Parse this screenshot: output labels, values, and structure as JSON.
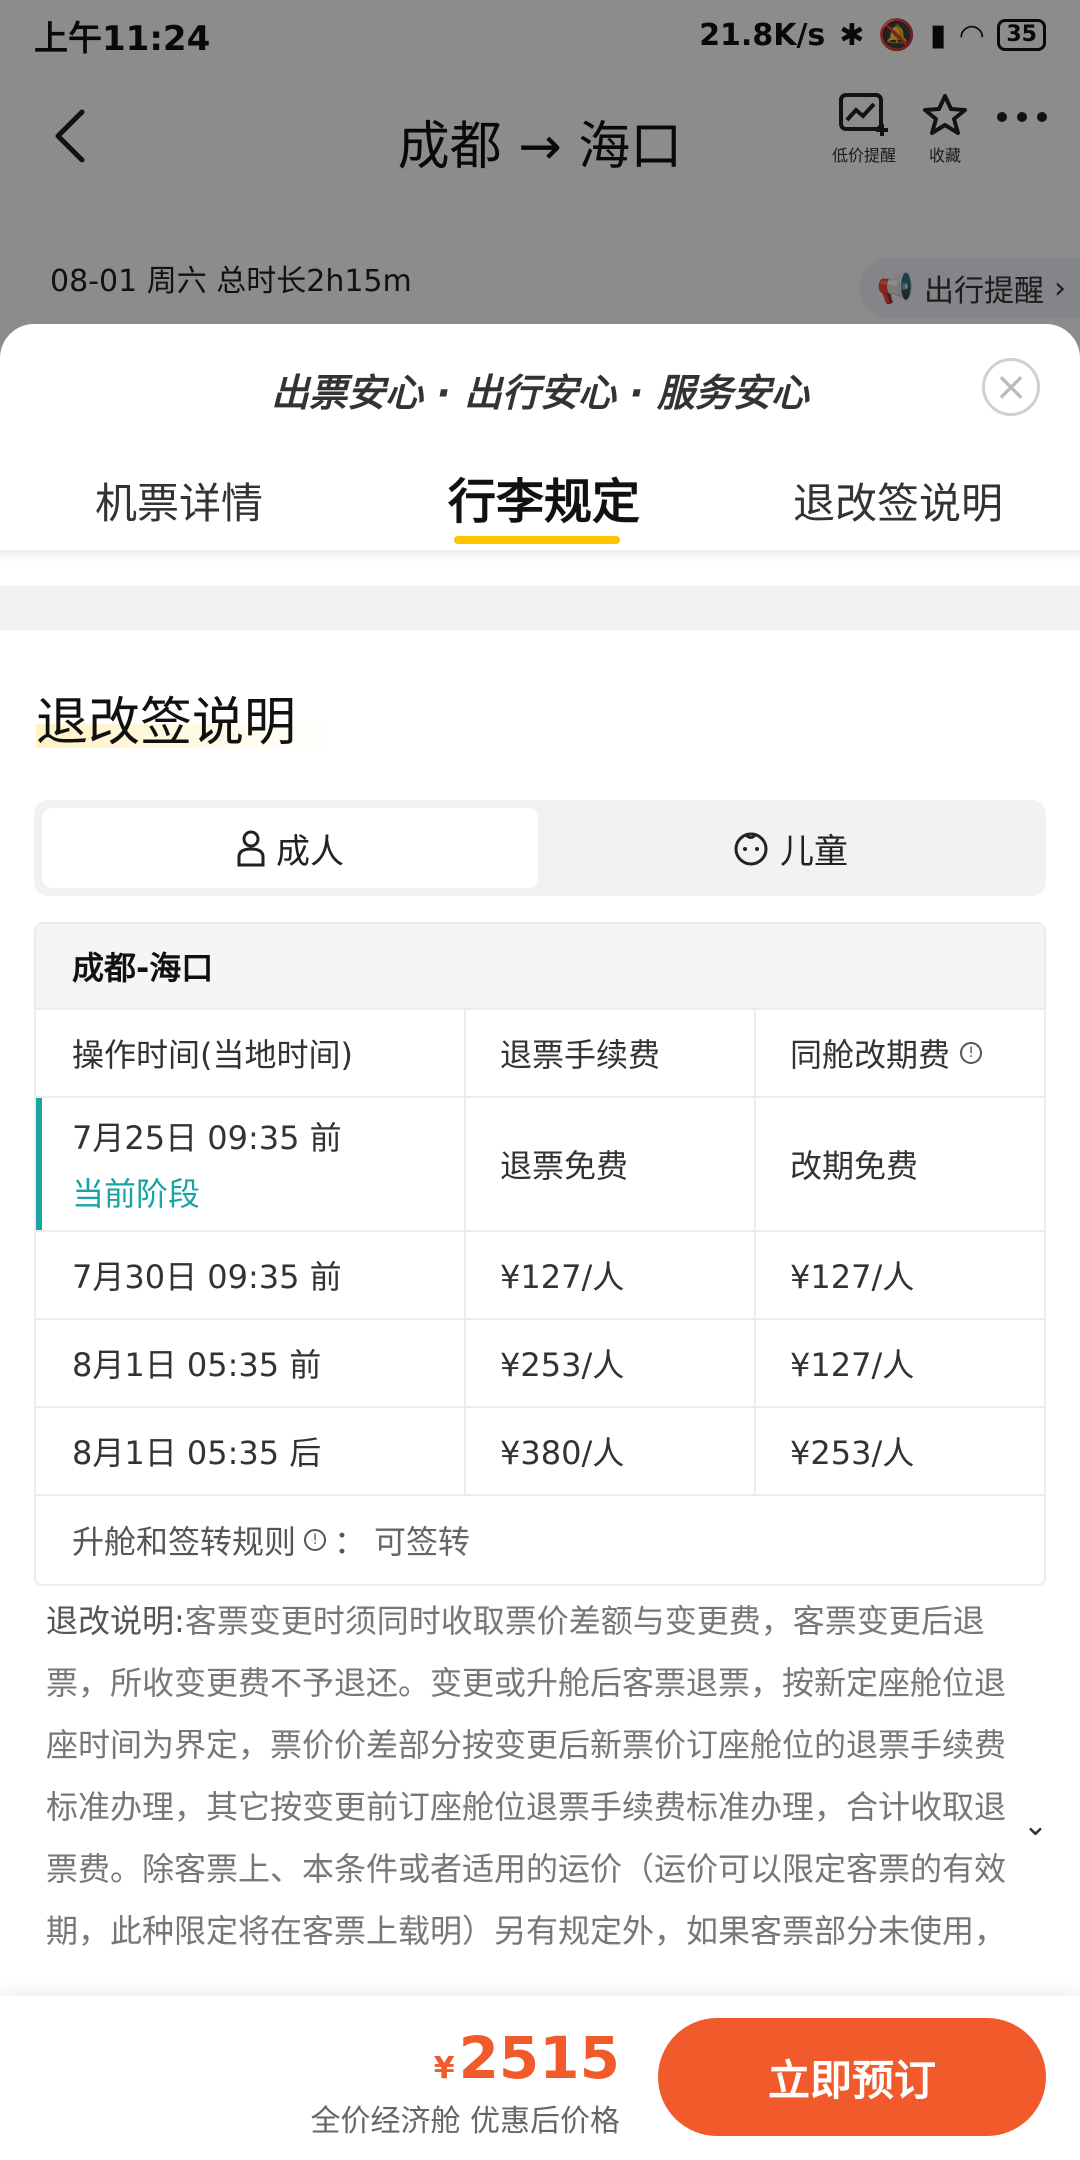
{
  "status_bar": {
    "time": "上午11:24",
    "network_speed": "21.8K/s",
    "battery": "35"
  },
  "header": {
    "title": "成都 → 海口",
    "low_price_alert_label": "低价提醒",
    "favorite_label": "收藏"
  },
  "trip": {
    "info": "08-01 周六  总时长2h15m",
    "travel_tip": "出行提醒"
  },
  "sheet": {
    "slogan": "出票安心 · 出行安心 · 服务安心",
    "tabs": [
      "机票详情",
      "行李规定",
      "退改签说明"
    ],
    "active_tab": 1,
    "section_title": "退改签说明",
    "passenger_types": [
      "成人",
      "儿童"
    ],
    "table": {
      "route": "成都-海口",
      "headers": [
        "操作时间(当地时间)",
        "退票手续费",
        "同舱改期费"
      ],
      "rows": [
        {
          "time": "7月25日 09:35 前",
          "stage": "当前阶段",
          "refund": "退票免费",
          "change": "改期免费"
        },
        {
          "time": "7月30日 09:35 前",
          "refund": "¥127/人",
          "change": "¥127/人"
        },
        {
          "time": "8月1日 05:35 前",
          "refund": "¥253/人",
          "change": "¥127/人"
        },
        {
          "time": "8月1日 05:35 后",
          "refund": "¥380/人",
          "change": "¥253/人"
        }
      ],
      "footer_label": "升舱和签转规则",
      "footer_value": "可签转"
    },
    "description_label": "退改说明:",
    "description": "客票变更时须同时收取票价差额与变更费，客票变更后退票，所收变更费不予退还。变更或升舱后客票退票，按新定座舱位退座时间为界定，票价价差部分按变更后新票价订座舱位的退票手续费标准办理，其它按变更前订座舱位退票手续费标准办理，合计收取退票费。除客票上、本条件或者适用的运价（运价可以限定客票的有效期，此种限定将在客票上载明）另有规定外，如果客票部分未使用，客票有效期自首段旅行之日起，一年内运输有效；如果客票全部未使用的（包括不定期客票），则…"
  },
  "bottom": {
    "currency": "¥",
    "price": "2515",
    "price_note": "全价经济舱 优惠后价格",
    "book_label": "立即预订"
  }
}
